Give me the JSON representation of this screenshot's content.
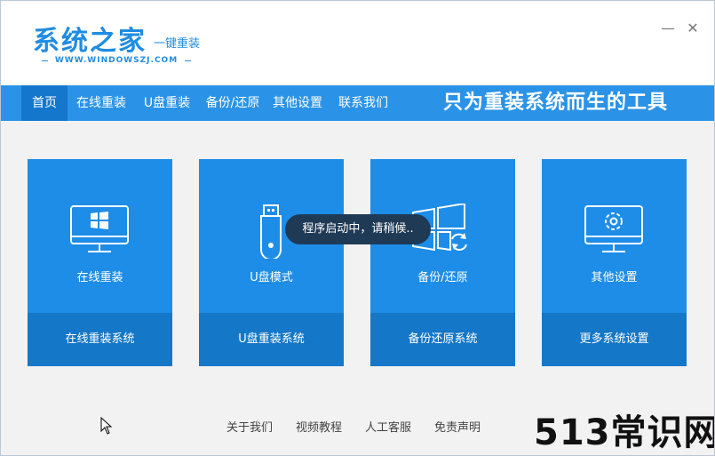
{
  "app": {
    "logo_title": "系统之家",
    "logo_subtitle": "一键重装",
    "logo_url": "WWW.WINDOWSZJ.COM",
    "minimize": "—",
    "close": "✕"
  },
  "nav": {
    "items": [
      {
        "label": "首页",
        "active": true
      },
      {
        "label": "在线重装"
      },
      {
        "label": "U盘重装"
      },
      {
        "label": "备份/还原"
      },
      {
        "label": "其他设置"
      },
      {
        "label": "联系我们"
      }
    ],
    "slogan": "只为重装系统而生的工具"
  },
  "cards": [
    {
      "label": "在线重装",
      "action": "在线重装系统",
      "icon": "monitor-windows-icon"
    },
    {
      "label": "U盘模式",
      "action": "U盘重装系统",
      "icon": "usb-drive-icon"
    },
    {
      "label": "备份/还原",
      "action": "备份还原系统",
      "icon": "windows-restore-icon"
    },
    {
      "label": "其他设置",
      "action": "更多系统设置",
      "icon": "monitor-gear-icon"
    }
  ],
  "toast": "程序启动中，请稍候..",
  "footer": {
    "links": [
      "关于我们",
      "视频教程",
      "人工客服",
      "免责声明"
    ]
  },
  "watermark": "513常识网",
  "colors": {
    "accent": "#1d8de8",
    "accent_dark": "#1577c7",
    "nav_bg": "#2a93e8",
    "toast_bg": "#1f3a55"
  }
}
